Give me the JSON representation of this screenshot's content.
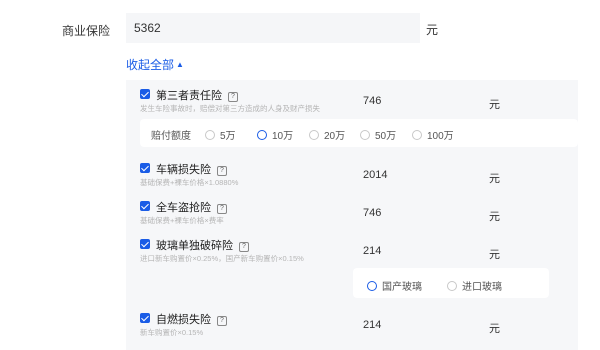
{
  "commercial_insurance": {
    "label": "商业保险",
    "value": "5362",
    "unit": "元"
  },
  "collapse_link": {
    "label": "收起全部",
    "icon": "caret-up-icon"
  },
  "help_glyph": "?",
  "items": [
    {
      "title": "第三者责任险",
      "desc": "发生车险事故时，赔偿对第三方造成的人身及财产损失",
      "value": "746",
      "unit": "元",
      "checked": true
    },
    {
      "title": "车辆损失险",
      "desc": "基础保费+裸车价格×1.0880%",
      "value": "2014",
      "unit": "元",
      "checked": true
    },
    {
      "title": "全车盗抢险",
      "desc": "基础保费+裸车价格×费率",
      "value": "746",
      "unit": "元",
      "checked": true
    },
    {
      "title": "玻璃单独破碎险",
      "desc": "进口新车购置价×0.25%，国产新车购置价×0.15%",
      "value": "214",
      "unit": "元",
      "checked": true
    },
    {
      "title": "自燃损失险",
      "desc": "新车购置价×0.15%",
      "value": "214",
      "unit": "元",
      "checked": true
    }
  ],
  "coverage_amount": {
    "label": "赔付额度",
    "options": [
      "5万",
      "10万",
      "20万",
      "50万",
      "100万"
    ],
    "selected": "10万"
  },
  "glass_type": {
    "options": [
      "国产玻璃",
      "进口玻璃"
    ],
    "selected": "国产玻璃"
  },
  "colors": {
    "accent": "#1a5ce6",
    "panel_bg": "#f6f7f9",
    "input_bg": "#f5f6f8"
  }
}
